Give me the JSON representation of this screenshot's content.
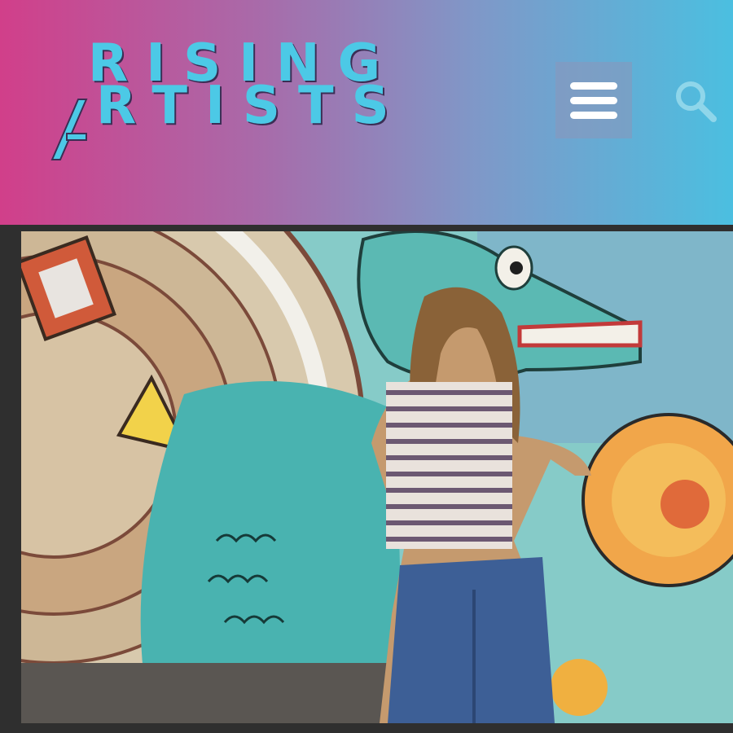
{
  "header": {
    "logo": {
      "line1": "RISING",
      "line2": "RTISTS",
      "slash_letter": "A"
    },
    "menu_icon": "hamburger-menu-icon",
    "search_icon": "search-icon"
  },
  "hero": {
    "image_description_icon": "mural-photo"
  },
  "colors": {
    "brand_cyan": "#4cc9e6",
    "gradient_left": "#d13f8a",
    "gradient_right": "#4bbfe0",
    "frame": "#2f2f2f"
  }
}
